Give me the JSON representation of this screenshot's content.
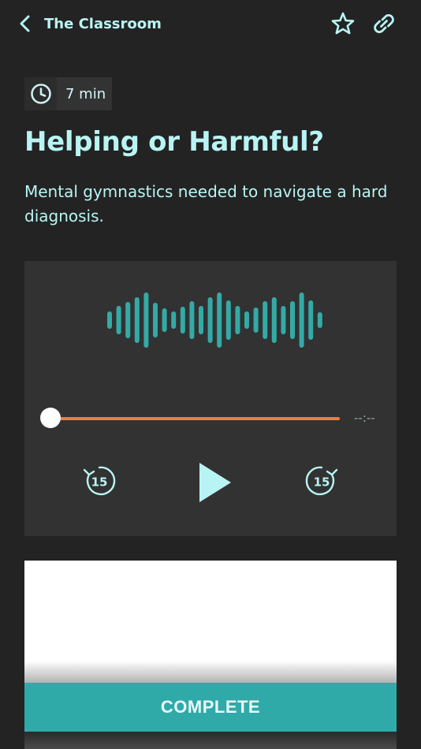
{
  "header": {
    "back_icon": "chevron-left-icon",
    "title": "The Classroom",
    "favorite_icon": "star-outline-icon",
    "share_icon": "link-icon"
  },
  "lesson": {
    "duration_icon": "clock-icon",
    "duration": "7 min",
    "title": "Helping or Harmful?",
    "subtitle": "Mental gymnastics needed to navigate a hard diagnosis."
  },
  "player": {
    "waveform_icon": "audio-waveform-icon",
    "time_remaining": "--:--",
    "progress": 0,
    "rewind_icon": "rewind-15-icon",
    "rewind_label": "15",
    "play_icon": "play-icon",
    "forward_icon": "forward-15-icon",
    "forward_label": "15"
  },
  "actions": {
    "complete_label": "COMPLETE"
  },
  "colors": {
    "background": "#232323",
    "accent_text": "#b9f4f4",
    "teal": "#30aaa9",
    "progress_track": "#ef7e3c",
    "player_bg": "#323232"
  }
}
